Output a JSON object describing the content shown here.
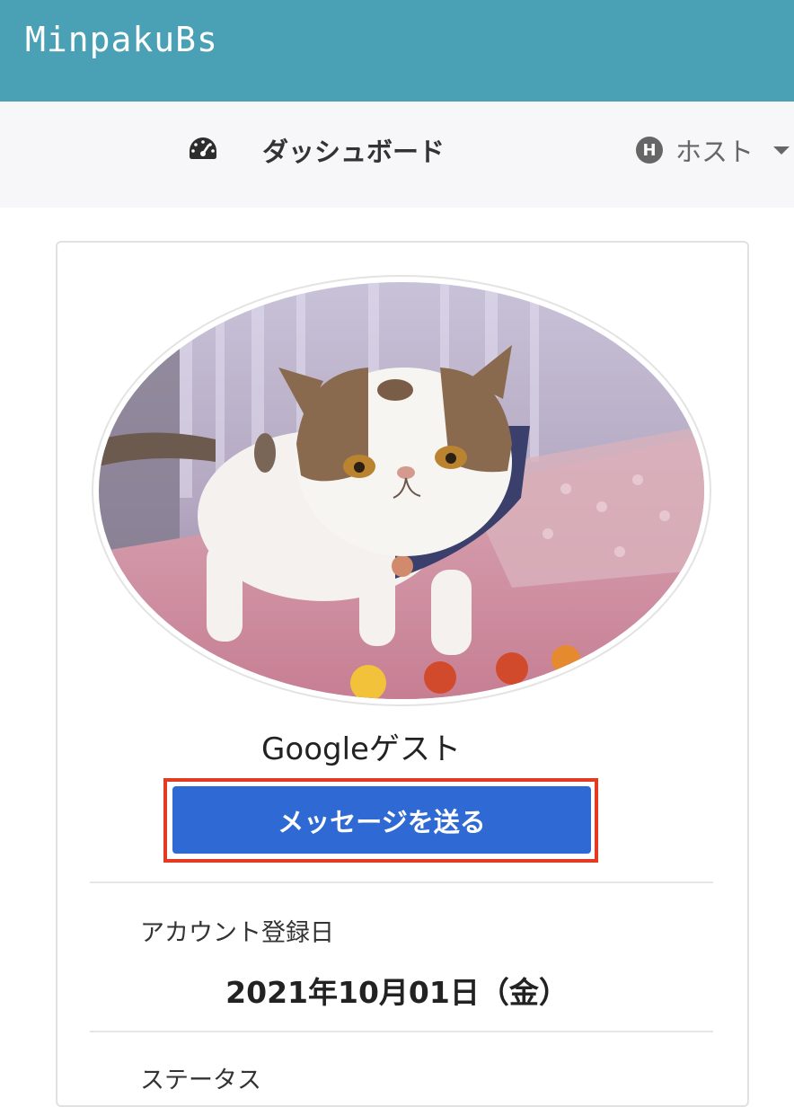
{
  "app": {
    "brand": "MinpakuBs"
  },
  "nav": {
    "dashboard_label": "ダッシュボード",
    "dashboard_icon": "speedometer-icon",
    "host_label": "ホスト",
    "host_icon": "letter-h-circle-icon",
    "host_icon_letter": "H"
  },
  "profile": {
    "name": "Googleゲスト",
    "message_button": "メッセージを送る",
    "fields": [
      {
        "label": "アカウント登録日",
        "value": "2021年10月01日（金）"
      },
      {
        "label": "ステータス"
      }
    ]
  },
  "colors": {
    "header": "#4aa0b5",
    "button": "#2f6ad4",
    "highlight": "#e53a22"
  }
}
